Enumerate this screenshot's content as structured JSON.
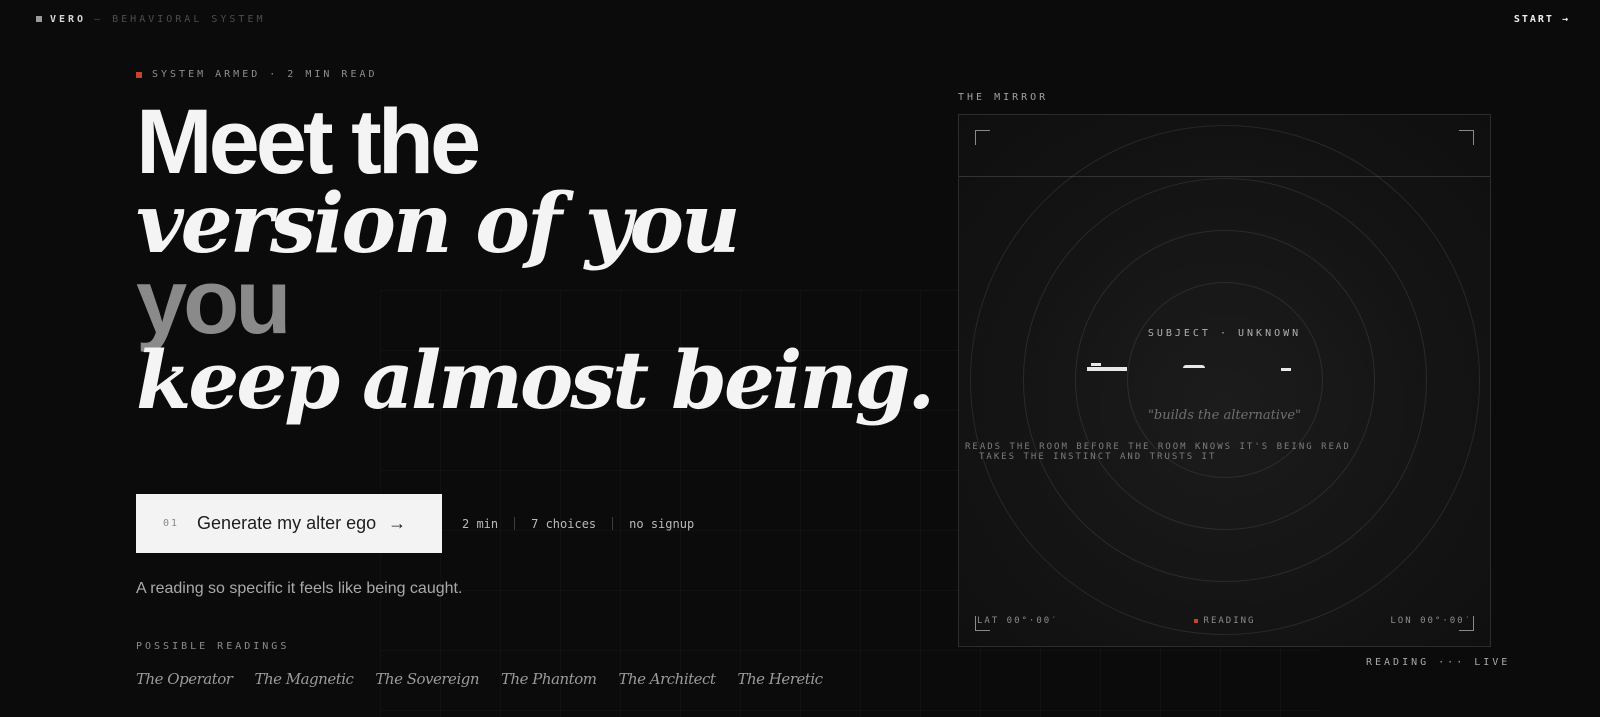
{
  "header": {
    "brand": "VERO",
    "tagline": "— BEHAVIORAL SYSTEM",
    "start_label": "START →"
  },
  "hero": {
    "status": "SYSTEM ARMED · 2 MIN READ",
    "headline": {
      "line1": "Meet the",
      "line2": "version of you",
      "line3": "you",
      "line4": "keep almost being."
    },
    "cta": {
      "number": "01",
      "label": "Generate my alter ego",
      "arrow": "→"
    },
    "meta": [
      "2 min",
      "7 choices",
      "no signup"
    ],
    "subline": "A reading so specific it feels like being caught.",
    "readings_label": "POSSIBLE READINGS",
    "readings": [
      "The Operator",
      "The Magnetic",
      "The Sovereign",
      "The Phantom",
      "The Architect",
      "The Heretic"
    ]
  },
  "mirror": {
    "label": "THE MIRROR",
    "subject": "SUBJECT · UNKNOWN",
    "quote": "\"builds the alternative\"",
    "trait_line_1": "READS THE ROOM BEFORE THE ROOM KNOWS IT'S BEING READ",
    "trait_line_2": "TAKES THE INSTINCT AND TRUSTS IT",
    "lat": "LAT 00°·00′",
    "status": "READING",
    "lon": "LON 00°·00′",
    "footer": "READING ··· LIVE"
  },
  "colors": {
    "background": "#0b0b0b",
    "accent": "#c2462c",
    "cta_bg": "#f3f3f3"
  }
}
